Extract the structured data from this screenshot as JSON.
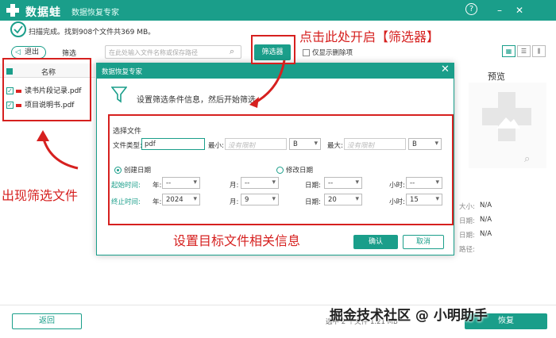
{
  "app": {
    "name": "数据蛙",
    "subtitle": "数据恢复专家"
  },
  "window_controls": {
    "help": "?",
    "minimize": "–",
    "close": "✕"
  },
  "scan": {
    "status": "扫描完成。找到908个文件共369 MB。"
  },
  "toolbar": {
    "back_label": "退出",
    "filter_label": "筛选",
    "search_placeholder": "在此处输入文件名称或保存路径",
    "filter_button": "筛选器",
    "only_deleted": "仅显示删除项"
  },
  "filelist": {
    "header": "名称",
    "items": [
      {
        "name": "读书片段记录.pdf"
      },
      {
        "name": "项目说明书.pdf"
      }
    ]
  },
  "preview": {
    "title": "预览",
    "info": [
      {
        "label": "大小:",
        "value": "N/A"
      },
      {
        "label": "日期:",
        "value": "N/A"
      },
      {
        "label": "日期:",
        "value": "N/A"
      },
      {
        "label": "路径:",
        "value": ""
      }
    ]
  },
  "dialog": {
    "title": "数据恢复专家",
    "description": "设置筛选条件信息，然后开始筛选",
    "section_label": "选择文件",
    "file_type_label": "文件类型:",
    "file_type_value": "pdf",
    "min_label": "最小:",
    "min_placeholder": "没有限制",
    "min_unit": "B",
    "max_label": "最大:",
    "max_placeholder": "没有限制",
    "max_unit": "B",
    "radio_created": "创建日期",
    "radio_modified": "修改日期",
    "start_label": "起始时间:",
    "end_label": "终止时间:",
    "year_label": "年:",
    "month_label": "月:",
    "day_label": "日期:",
    "hour_label": "小时:",
    "start": {
      "year": "--",
      "month": "--",
      "day": "--",
      "hour": "--"
    },
    "end": {
      "year": "2024",
      "month": "9",
      "day": "20",
      "hour": "15"
    },
    "ok": "确认",
    "cancel": "取消"
  },
  "annotations": {
    "top_right": "点击此处开启【筛选器】",
    "left": "出现筛选文件",
    "bottom": "设置目标文件相关信息"
  },
  "footer": {
    "return": "返回",
    "recover": "恢复",
    "selected": "选中 2 个文件 1.21 MB"
  },
  "watermark": "掘金技术社区 @ 小明助手",
  "colors": {
    "brand": "#1a9e8a",
    "annotation": "#d6201f"
  }
}
